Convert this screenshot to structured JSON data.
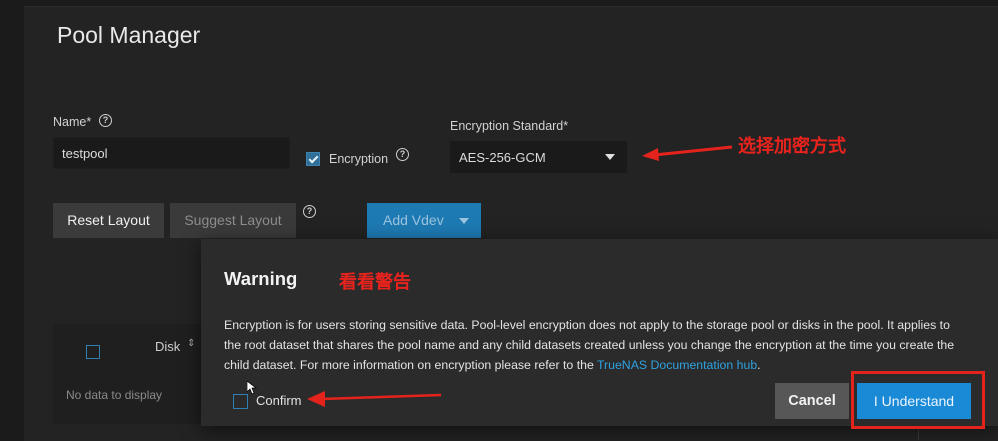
{
  "page": {
    "title": "Pool Manager"
  },
  "form": {
    "name_label": "Name*",
    "name_value": "testpool",
    "encryption_label": "Encryption",
    "encryption_checked": true,
    "encryption_standard_label": "Encryption Standard*",
    "encryption_standard_value": "AES-256-GCM"
  },
  "toolbar": {
    "reset_layout": "Reset Layout",
    "suggest_layout": "Suggest Layout",
    "add_vdev": "Add Vdev"
  },
  "table": {
    "column_disk": "Disk",
    "empty_text": "No data to display"
  },
  "dialog": {
    "title": "Warning",
    "body_text": "Encryption is for users storing sensitive data. Pool-level encryption does not apply to the storage pool or disks in the pool. It applies to the root dataset that shares the pool name and any child datasets created unless you change the encryption at the time you create the child dataset. For more information on encryption please refer to the ",
    "link_text": "TrueNAS Documentation hub",
    "body_end": ".",
    "confirm_label": "Confirm",
    "confirm_checked": false,
    "cancel_label": "Cancel",
    "understand_label": "I Understand"
  },
  "annotations": {
    "choose_encryption": "选择加密方式",
    "read_warning": "看看警告"
  },
  "icons": {
    "help": "help-circle-icon",
    "select_caret": "caret-down-icon",
    "sort": "sort-icon"
  },
  "colors": {
    "accent": "#1b8ad6",
    "annotation_red": "#e5231d",
    "background": "#1b1b1b"
  }
}
